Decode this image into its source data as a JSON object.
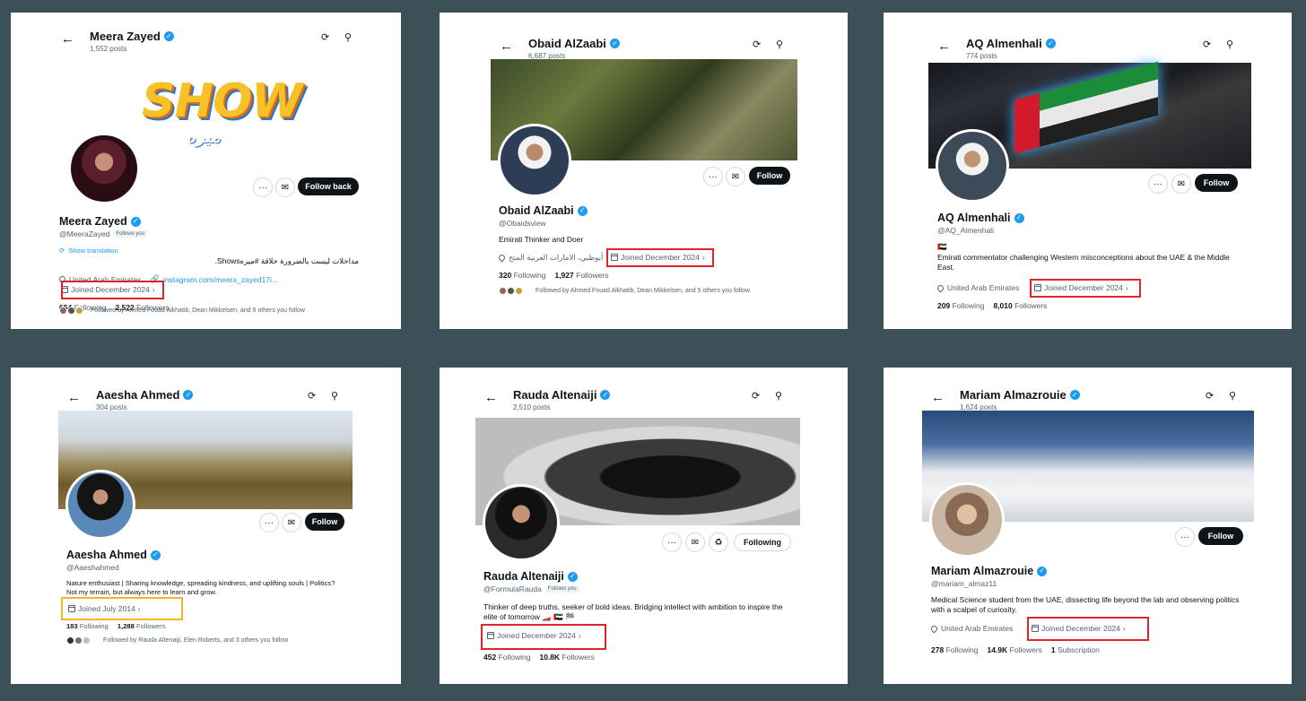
{
  "common": {
    "back_icon": "arrow-left-icon",
    "refresh_icon": "refresh-icon",
    "search_icon": "search-icon",
    "check": "✓",
    "more": "···",
    "mail": "✉",
    "chevron": "›",
    "follows_you": "Follows you"
  },
  "profiles": [
    {
      "header_name": "Meera Zayed",
      "header_posts": "1,552 posts",
      "name": "Meera Zayed",
      "handle": "@MeeraZayed",
      "button": "Follow back",
      "show_logo": "SHOW",
      "show_logo_script": "ميره",
      "translation": "Show translation",
      "bio": "مداخلات ليست بالضرورة خلاقة #ميرهShows.",
      "location": "United Arab Emirates",
      "link": "instagram.com/meera_zayed17i...",
      "joined": "Joined December 2024",
      "following_count": "654",
      "following_label": "Following",
      "followers_count": "2,522",
      "followers_label": "Followers",
      "followed_by": "Followed by Ahmed Fouad Alkhatib, Dean Mikkelsen, and 6 others you follow",
      "highlight": "red"
    },
    {
      "header_name": "Obaid AlZaabi",
      "header_posts": "6,687 posts",
      "name": "Obaid AlZaabi",
      "handle": "@Obaidsview",
      "button": "Follow",
      "bio": "Emirati Thinker and Doer",
      "location": "أبوظبي، الامارات العربية المتح",
      "joined": "Joined December 2024",
      "following_count": "320",
      "following_label": "Following",
      "followers_count": "1,927",
      "followers_label": "Followers",
      "followed_by": "Followed by Ahmed Fouad Alkhatib, Dean Mikkelsen, and 5 others you follow",
      "highlight": "red"
    },
    {
      "header_name": "AQ Almenhali",
      "header_posts": "774 posts",
      "name": "AQ Almenhali",
      "handle": "@AQ_Almenhali",
      "button": "Follow",
      "flag": "🇦🇪",
      "bio": "Emirati commentator challenging Western misconceptions about the UAE & the Middle East.",
      "location": "United Arab Emirates",
      "joined": "Joined December 2024",
      "following_count": "209",
      "following_label": "Following",
      "followers_count": "8,010",
      "followers_label": "Followers",
      "highlight": "red"
    },
    {
      "header_name": "Aaesha Ahmed",
      "header_posts": "304 posts",
      "name": "Aaesha Ahmed",
      "handle": "@Aaeshahmed",
      "button": "Follow",
      "bio": "Nature enthusiast | Sharing knowledge, spreading kindness, and uplifting souls | Politics? Not my terrain, but always here to learn and grow.",
      "joined": "Joined July 2014",
      "following_count": "183",
      "following_label": "Following",
      "followers_count": "1,288",
      "followers_label": "Followers",
      "followed_by": "Followed by Rauda Altenaiji, Elen Roberts, and 3 others you follow",
      "highlight": "yellow"
    },
    {
      "header_name": "Rauda Altenaiji",
      "header_posts": "2,510 posts",
      "name": "Rauda Altenaiji",
      "handle": "@FormulaRauda",
      "button": "Following",
      "bio": "Thinker of deep truths, seeker of bold ideas. Bridging intellect with ambition to inspire the elite of tomorrow 🏎️ 🇦🇪 🏁",
      "joined": "Joined December 2024",
      "following_count": "452",
      "following_label": "Following",
      "followers_count": "10.8K",
      "followers_label": "Followers",
      "highlight": "red"
    },
    {
      "header_name": "Mariam Almazrouie",
      "header_posts": "1,624 posts",
      "name": "Mariam Almazrouie",
      "handle": "@mariam_almaz11",
      "button": "Follow",
      "bio": "Medical Science student from the UAE, dissecting life beyond the lab and observing politics with a scalpel of curiosity.",
      "location": "United Arab Emirates",
      "joined": "Joined December 2024",
      "following_count": "278",
      "following_label": "Following",
      "followers_count": "14.9K",
      "followers_label": "Followers",
      "subscription_count": "1",
      "subscription_label": "Subscription",
      "highlight": "red"
    }
  ]
}
